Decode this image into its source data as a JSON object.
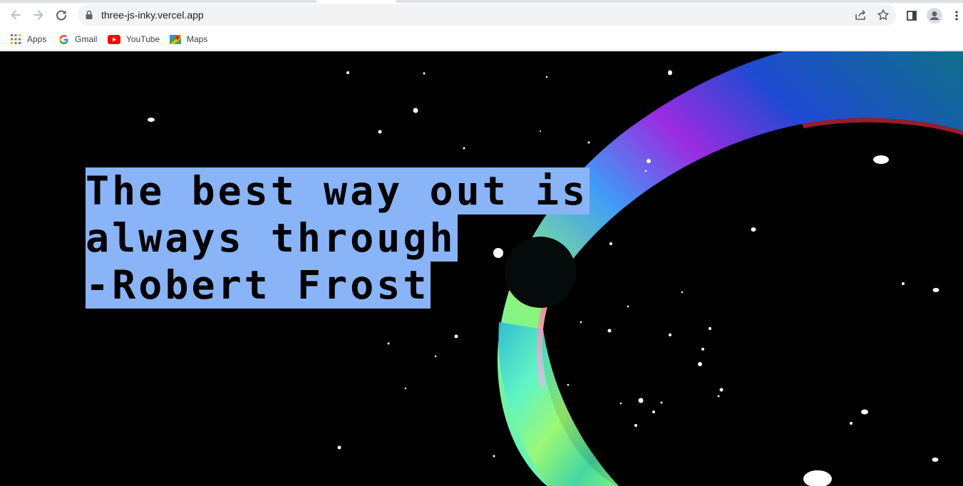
{
  "browser": {
    "url": "three-js-inky.vercel.app",
    "nav": {
      "back_icon": "arrow-left-icon",
      "forward_icon": "arrow-right-icon",
      "reload_icon": "reload-icon"
    },
    "omnibox_icons": [
      "lock-icon",
      "share-icon",
      "star-icon"
    ],
    "toolbar_icons": [
      "side-panel-icon",
      "profile-avatar-icon",
      "kebab-menu-icon"
    ]
  },
  "bookmarks": [
    {
      "label": "Apps",
      "icon": "apps-grid-icon"
    },
    {
      "label": "Gmail",
      "icon": "google-g-icon"
    },
    {
      "label": "YouTube",
      "icon": "youtube-icon"
    },
    {
      "label": "Maps",
      "icon": "maps-pin-icon"
    }
  ],
  "page": {
    "quote": {
      "line1": "The best way out is",
      "line2": "always through",
      "line3": "-Robert Frost"
    },
    "colors": {
      "background": "#000000",
      "selection_highlight": "#8ab4f8",
      "sphere": "#050a0a",
      "stars": "#ffffff"
    }
  }
}
